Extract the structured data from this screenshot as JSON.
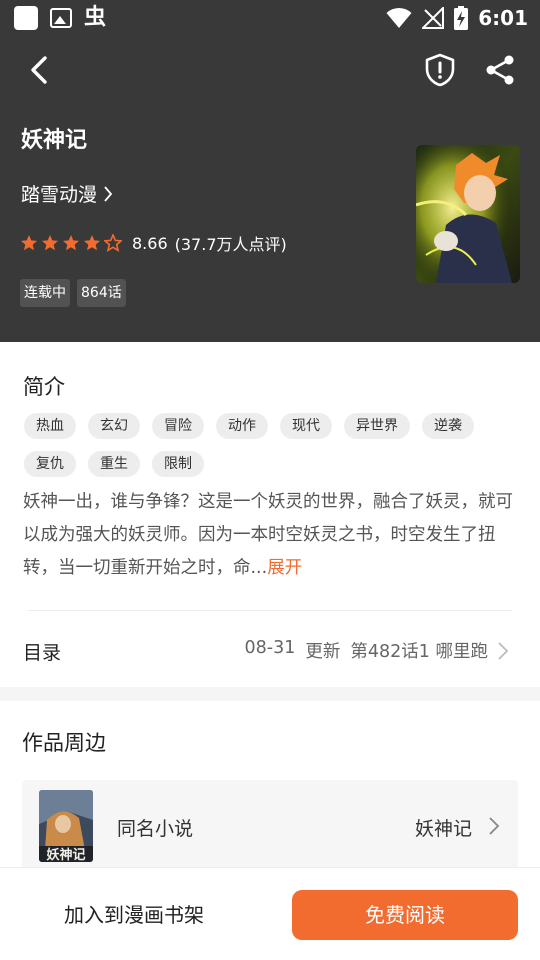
{
  "status_bar": {
    "time": "6:01",
    "app_glyph": "虫"
  },
  "header": {
    "title": "妖神记",
    "author": "踏雪动漫",
    "rating": {
      "score": "8.66",
      "count_text": "(37.7万人点评)",
      "stars_filled": 4,
      "stars_total": 5
    },
    "badges": [
      "连载中",
      "864话"
    ]
  },
  "intro": {
    "heading": "简介",
    "tags": [
      "热血",
      "玄幻",
      "冒险",
      "动作",
      "现代",
      "异世界",
      "逆袭",
      "复仇",
      "重生",
      "限制"
    ],
    "description": "妖神一出，谁与争锋？这是一个妖灵的世界，融合了妖灵，就可以成为强大的妖灵师。因为一本时空妖灵之书，时空发生了扭转，当一切重新开始之时，命...",
    "expand_label": "展开"
  },
  "toc": {
    "label": "目录",
    "date": "08-31",
    "update_label": "更新",
    "latest": "第482话1 哪里跑"
  },
  "merch": {
    "heading": "作品周边",
    "item_label": "同名小说",
    "item_name": "妖神记",
    "thumb_text": "妖神记"
  },
  "bottom": {
    "shelf_label": "加入到漫画书架",
    "read_label": "免费阅读"
  },
  "colors": {
    "accent": "#f26b2f",
    "hero_bg": "#393939",
    "badge_bg": "#525252",
    "tag_bg": "#ededed"
  },
  "icons": [
    "back-icon",
    "shield-alert-icon",
    "share-icon",
    "star-icon",
    "chevron-right-icon",
    "wifi-icon",
    "signal-icon",
    "battery-icon"
  ]
}
